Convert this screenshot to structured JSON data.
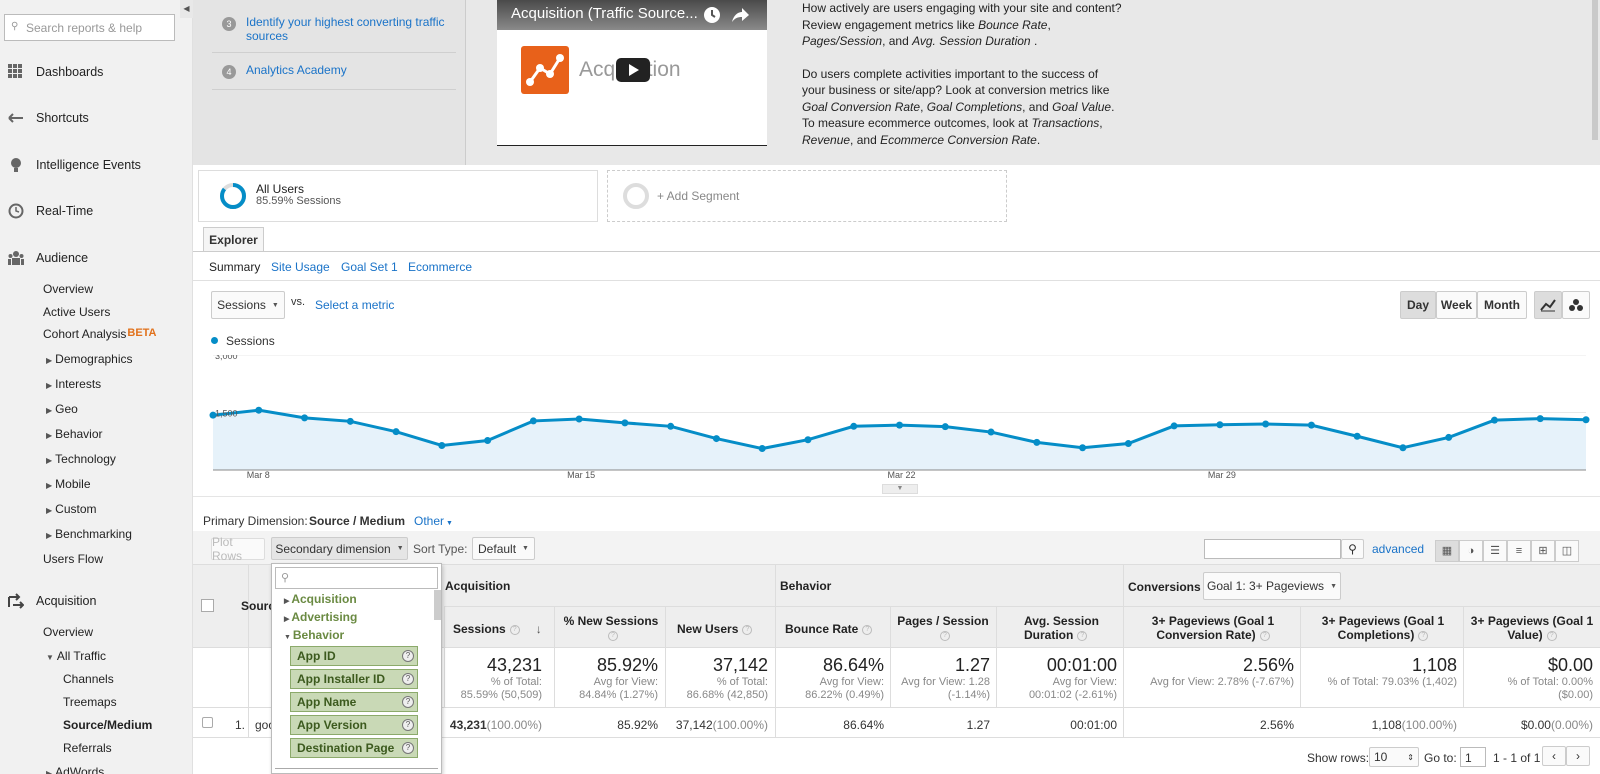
{
  "sidebar": {
    "search_placeholder": "Search reports & help",
    "main": {
      "dashboards": "Dashboards",
      "shortcuts": "Shortcuts",
      "intelligence": "Intelligence Events",
      "realtime": "Real-Time",
      "audience": "Audience",
      "acquisition": "Acquisition"
    },
    "audience_items": {
      "overview": "Overview",
      "active_users": "Active Users",
      "cohort": "Cohort Analysis",
      "beta": "BETA",
      "demographics": "Demographics",
      "interests": "Interests",
      "geo": "Geo",
      "behavior": "Behavior",
      "technology": "Technology",
      "mobile": "Mobile",
      "custom": "Custom",
      "benchmarking": "Benchmarking",
      "users_flow": "Users Flow"
    },
    "acq_items": {
      "overview": "Overview",
      "all_traffic": "All Traffic",
      "channels": "Channels",
      "treemaps": "Treemaps",
      "source_medium": "Source/Medium",
      "referrals": "Referrals",
      "adwords": "AdWords"
    }
  },
  "steps": [
    {
      "num": "3",
      "text": "Identify your highest converting traffic sources"
    },
    {
      "num": "4",
      "text": "Analytics Academy"
    }
  ],
  "video": {
    "title": "Acquisition (Traffic Source...",
    "logo_text": "Acquisition"
  },
  "description": {
    "p1": "How actively are users engaging with your site and content? Review engagement metrics like Bounce Rate, Pages/Session, and Avg. Session Duration .",
    "p2": "Do users complete activities important to the success of your business or site/app? Look at conversion metrics like Goal Conversion Rate, Goal Completions, and Goal Value. To measure ecommerce outcomes, look at Transactions, Revenue, and Ecommerce Conversion Rate."
  },
  "segments": {
    "name": "All Users",
    "pct": "85.59% Sessions",
    "add": "+ Add Segment"
  },
  "tabs": {
    "explorer": "Explorer",
    "summary": "Summary",
    "site_usage": "Site Usage",
    "goal_set": "Goal Set 1",
    "ecommerce": "Ecommerce"
  },
  "chart_controls": {
    "metric": "Sessions",
    "vs": "vs.",
    "select_metric": "Select a metric",
    "day": "Day",
    "week": "Week",
    "month": "Month"
  },
  "chart_data": {
    "type": "area",
    "series": [
      {
        "name": "Sessions",
        "values": [
          1430,
          1560,
          1360,
          1270,
          1000,
          640,
          770,
          1280,
          1330,
          1230,
          1140,
          820,
          560,
          790,
          1140,
          1170,
          1130,
          990,
          720,
          580,
          690,
          1150,
          1180,
          1200,
          1170,
          880,
          580,
          850,
          1300,
          1340,
          1310
        ]
      }
    ],
    "x_labels": [
      "Mar 8",
      "Mar 15",
      "Mar 22",
      "Mar 29"
    ],
    "y_ticks": [
      "3,000",
      "1,500"
    ],
    "ylim": [
      0,
      3000
    ],
    "color": "#058dc7",
    "fill": "#e6f2fa"
  },
  "table_controls": {
    "primary_label": "Primary Dimension:",
    "primary_value": "Source / Medium",
    "other": "Other",
    "plot_rows": "Plot Rows",
    "secondary": "Secondary dimension",
    "sort_type_label": "Sort Type:",
    "sort_type": "Default",
    "advanced": "advanced",
    "conversions": "Conversions",
    "goal_select": "Goal 1: 3+ Pageviews"
  },
  "table": {
    "group_acq": "Acquisition",
    "group_beh": "Behavior",
    "source_col": "Source",
    "headers": {
      "sessions": "Sessions",
      "new_sessions": "% New Sessions",
      "new_users": "New Users",
      "bounce": "Bounce Rate",
      "pages": "Pages / Session",
      "duration": "Avg. Session Duration",
      "conv_rate": "3+ Pageviews (Goal 1 Conversion Rate)",
      "completions": "3+ Pageviews (Goal 1 Completions)",
      "value": "3+ Pageviews (Goal 1 Value)"
    },
    "totals": {
      "sessions": [
        "43,231",
        "% of Total:",
        "85.59% (50,509)"
      ],
      "new_sessions": [
        "85.92%",
        "Avg for View:",
        "84.84% (1.27%)"
      ],
      "new_users": [
        "37,142",
        "% of Total:",
        "86.68% (42,850)"
      ],
      "bounce": [
        "86.64%",
        "Avg for View:",
        "86.22% (0.49%)"
      ],
      "pages": [
        "1.27",
        "Avg for View: 1.28",
        "(-1.14%)"
      ],
      "duration": [
        "00:01:00",
        "Avg for View:",
        "00:01:02 (-2.61%)"
      ],
      "conv_rate": [
        "2.56%",
        "Avg for View: 2.78% (-7.67%)",
        ""
      ],
      "completions": [
        "1,108",
        "% of Total: 79.03% (1,402)",
        ""
      ],
      "value": [
        "$0.00",
        "% of Total: 0.00%",
        "($0.00)"
      ]
    },
    "row1": {
      "idx": "1.",
      "source": "goo",
      "sessions": "43,231",
      "sessions_pct": "(100.00%)",
      "new_sessions": "85.92%",
      "new_users": "37,142",
      "new_users_pct": "(100.00%)",
      "bounce": "86.64%",
      "pages": "1.27",
      "duration": "00:01:00",
      "conv_rate": "2.56%",
      "completions": "1,108",
      "completions_pct": "(100.00%)",
      "value": "$0.00",
      "value_pct": "(0.00%)"
    }
  },
  "dropdown": {
    "categories": {
      "acq": "Acquisition",
      "adv": "Advertising",
      "beh": "Behavior"
    },
    "items": [
      "App ID",
      "App Installer ID",
      "App Name",
      "App Version",
      "Destination Page"
    ]
  },
  "pager": {
    "show_rows": "Show rows:",
    "rows": "10",
    "goto": "Go to:",
    "page": "1",
    "range": "1 - 1 of 1"
  }
}
